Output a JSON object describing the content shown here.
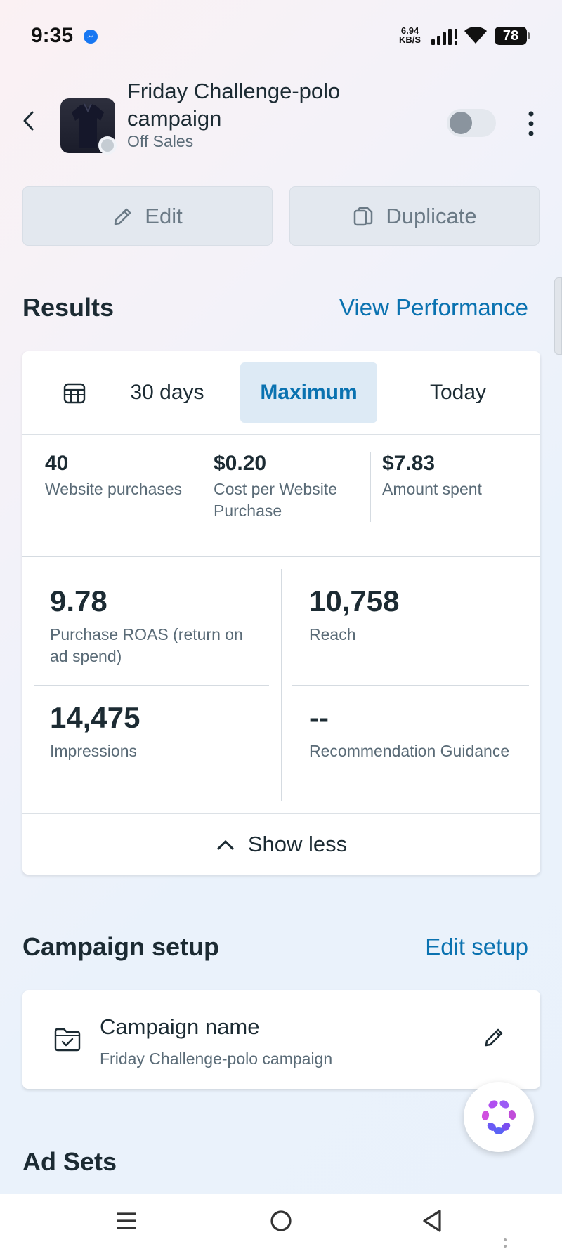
{
  "status_bar": {
    "time": "9:35",
    "net_speed_value": "6.94",
    "net_speed_unit": "KB/S",
    "battery": "78"
  },
  "header": {
    "campaign_title": "Friday Challenge-polo campaign",
    "status_text": "Off Sales"
  },
  "actions": {
    "edit_label": "Edit",
    "duplicate_label": "Duplicate"
  },
  "results": {
    "heading": "Results",
    "link": "View Performance",
    "tabs": [
      {
        "label": "30 days",
        "selected": false
      },
      {
        "label": "Maximum",
        "selected": true
      },
      {
        "label": "Today",
        "selected": false
      }
    ],
    "summary_metrics": [
      {
        "value": "40",
        "label": "Website purchases"
      },
      {
        "value": "$0.20",
        "label": "Cost per Website Purchase"
      },
      {
        "value": "$7.83",
        "label": "Amount spent"
      }
    ],
    "detail_metrics": [
      {
        "value": "9.78",
        "label": "Purchase ROAS (return on ad spend)"
      },
      {
        "value": "10,758",
        "label": "Reach"
      },
      {
        "value": "14,475",
        "label": "Impressions"
      },
      {
        "value": "--",
        "label": "Recommendation Guidance"
      }
    ],
    "show_less_label": "Show less"
  },
  "campaign_setup": {
    "heading": "Campaign setup",
    "link": "Edit setup",
    "field_label": "Campaign name",
    "field_value": "Friday Challenge-polo campaign"
  },
  "ad_sets": {
    "heading": "Ad Sets"
  },
  "colors": {
    "accent_link": "#0a72b0",
    "selected_tab_bg": "#ddeaf5",
    "text_primary": "#1c2b33",
    "text_secondary": "#5a6b77"
  },
  "icons": [
    "messenger-icon",
    "signal-icon",
    "wifi-icon",
    "battery-icon",
    "back-arrow-icon",
    "more-vertical-icon",
    "pencil-icon",
    "duplicate-icon",
    "calendar-icon",
    "chevron-up-icon",
    "folder-check-icon",
    "ai-assistant-icon",
    "menu-icon",
    "home-circle-icon",
    "back-triangle-icon"
  ]
}
